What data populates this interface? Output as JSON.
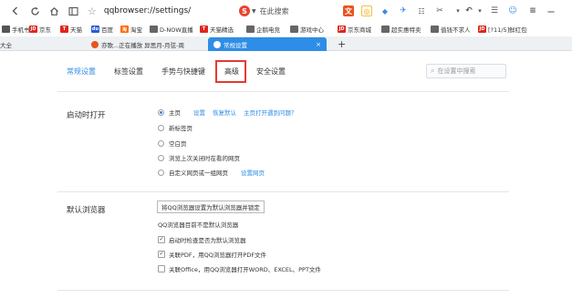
{
  "toolbar": {
    "address": "qqbrowser://settings/",
    "search_placeholder": "在此搜索"
  },
  "bookmarks": [
    {
      "label": "手机书签",
      "color": "#555555",
      "glyph": ""
    },
    {
      "label": "京东",
      "color": "#e1251b",
      "glyph": "JD"
    },
    {
      "label": "天猫",
      "color": "#e1251b",
      "glyph": "T"
    },
    {
      "label": "百度",
      "color": "#2b5bd6",
      "glyph": "du"
    },
    {
      "label": "淘宝",
      "color": "#ff6a00",
      "glyph": "淘"
    },
    {
      "label": "D-NOW直播",
      "color": "#666666",
      "glyph": ""
    },
    {
      "label": "天猫精选",
      "color": "#e1251b",
      "glyph": "T"
    },
    {
      "label": "企鹅电竞",
      "color": "#666666",
      "glyph": ""
    },
    {
      "label": "游戏中心",
      "color": "#666666",
      "glyph": ""
    },
    {
      "label": "京东商城",
      "color": "#e1251b",
      "glyph": "JD"
    },
    {
      "label": "超实惠特卖",
      "color": "#666666",
      "glyph": ""
    },
    {
      "label": "值钱不求人",
      "color": "#666666",
      "glyph": ""
    },
    {
      "label": "[?11/5]鲜红包",
      "color": "#e1251b",
      "glyph": "JD"
    }
  ],
  "tabs": {
    "partial_left": "大全",
    "inactive_title": "亦歌...正在播放 异思月-月弦-周",
    "active_title": "常规设置",
    "new_tab": "+"
  },
  "settings": {
    "tabs": [
      "常规设置",
      "标签设置",
      "手势与快捷键",
      "高级",
      "安全设置"
    ],
    "active_tab": "常规设置",
    "search_placeholder": "在设置中搜索",
    "startup": {
      "title": "启动时打开",
      "options": [
        {
          "label": "主页",
          "selected": true,
          "links": [
            "设置",
            "恢复默认",
            "主页打开遇到问题？"
          ]
        },
        {
          "label": "新标签页",
          "selected": false,
          "links": []
        },
        {
          "label": "空白页",
          "selected": false,
          "links": []
        },
        {
          "label": "浏览上次关闭时在看的网页",
          "selected": false,
          "links": []
        },
        {
          "label": "自定义网页或一组网页",
          "selected": false,
          "links": [
            "设置网页"
          ]
        }
      ]
    },
    "default_browser": {
      "title": "默认浏览器",
      "button": "将QQ浏览器设置为默认浏览器并锁定",
      "status": "QQ浏览器目前不是默认浏览器",
      "checks": [
        {
          "label": "启动时检查是否为默认浏览器",
          "checked": true
        },
        {
          "label": "关联PDF，用QQ浏览器打开PDF文件",
          "checked": true
        },
        {
          "label": "关联Office，用QQ浏览器打开WORD、EXCEL、PPT文件",
          "checked": false
        }
      ]
    }
  },
  "colors": {
    "accent": "#2e8de6",
    "highlight_box": "#e53935"
  }
}
